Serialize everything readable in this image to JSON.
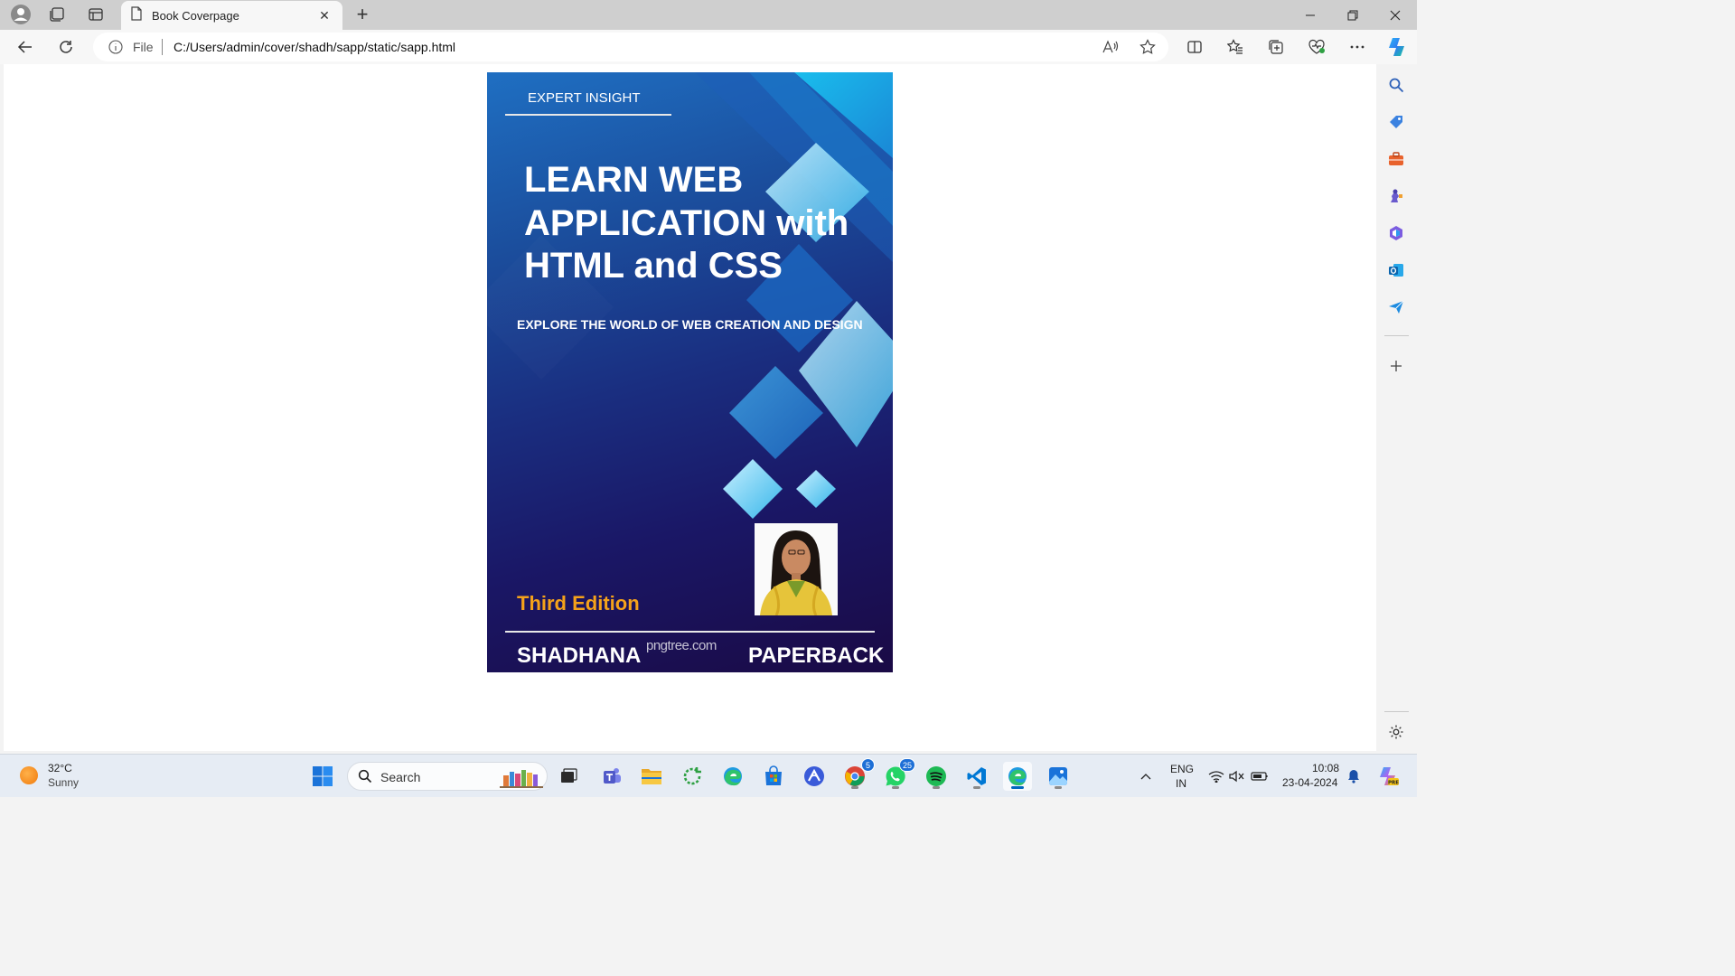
{
  "browser": {
    "tab_title": "Book Coverpage",
    "address_scheme": "File",
    "address_url": "C:/Users/admin/cover/shadh/sapp/static/sapp.html"
  },
  "cover": {
    "badge": "EXPERT INSIGHT",
    "title_line1": "LEARN WEB",
    "title_line2": "APPLICATION with",
    "title_line3": "HTML and CSS",
    "subtitle": "EXPLORE THE WORLD OF WEB CREATION AND DESIGN",
    "edition": "Third Edition",
    "author": "SHADHANA",
    "watermark": "pngtree.com",
    "format": "PAPERBACK",
    "colors": {
      "edition": "#f5a21a",
      "bg_top": "#1f6fc2",
      "bg_bottom": "#1a0a45"
    }
  },
  "taskbar": {
    "weather_temp": "32°C",
    "weather_desc": "Sunny",
    "search_label": "Search",
    "chrome_badge": "5",
    "whatsapp_badge": "25",
    "lang_line1": "ENG",
    "lang_line2": "IN",
    "time": "10:08",
    "date": "23-04-2024"
  }
}
